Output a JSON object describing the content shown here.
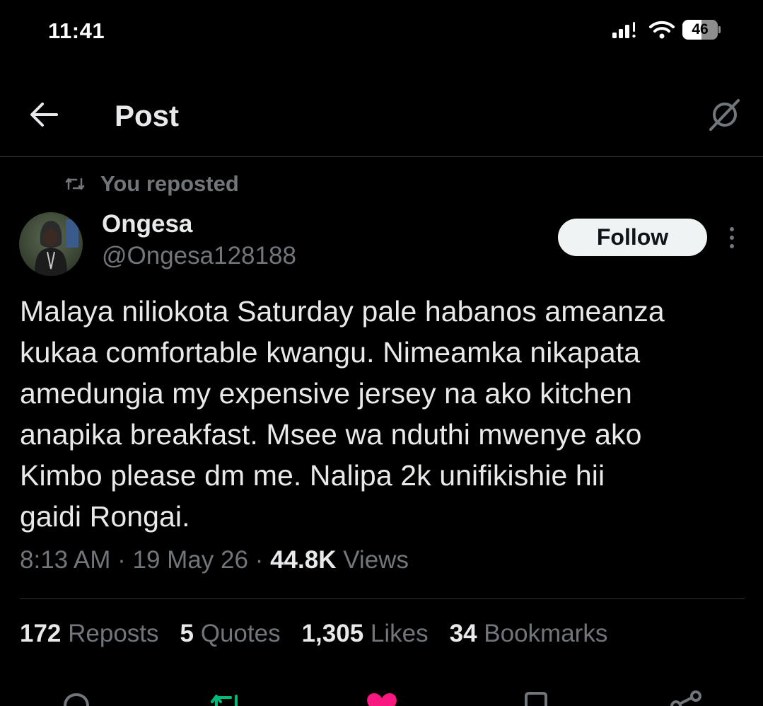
{
  "status_bar": {
    "time": "11:41",
    "battery": "46",
    "icons": [
      "signal-icon",
      "wifi-icon",
      "battery-icon"
    ]
  },
  "header": {
    "back_icon": "arrow-left-icon",
    "title": "Post",
    "grok_icon": "grok-icon"
  },
  "repost_context": {
    "icon": "repost-icon",
    "label": "You reposted"
  },
  "author": {
    "name": "Ongesa",
    "handle": "@Ongesa128188",
    "follow_label": "Follow",
    "more_icon": "more-vertical-icon"
  },
  "tweet": {
    "text": "Malaya niliokota Saturday pale habanos ameanza\nkukaa comfortable kwangu. Nimeamka nikapata\namedungia my expensive jersey na ako kitchen\nanapika breakfast. Msee wa nduthi mwenye ako\nKimbo please dm me. Nalipa 2k unifikishie hii\ngaidi Rongai.",
    "time": "8:13 AM",
    "sep1": " · ",
    "date": "19 May 26",
    "sep2": " · ",
    "views_count": "44.8K",
    "views_label": " Views"
  },
  "stats": [
    {
      "num": "172",
      "label": " Reposts"
    },
    {
      "num": "5",
      "label": " Quotes"
    },
    {
      "num": "1,305",
      "label": " Likes"
    },
    {
      "num": "34",
      "label": " Bookmarks"
    }
  ],
  "actions": [
    "reply-icon",
    "repost-icon",
    "like-icon",
    "bookmark-icon",
    "share-icon"
  ],
  "colors": {
    "background": "#000000",
    "text_primary": "#e7e9ea",
    "text_secondary": "#71767b",
    "divider": "#2f3336",
    "repost_active": "#00ba7c",
    "like_active": "#f91880"
  }
}
